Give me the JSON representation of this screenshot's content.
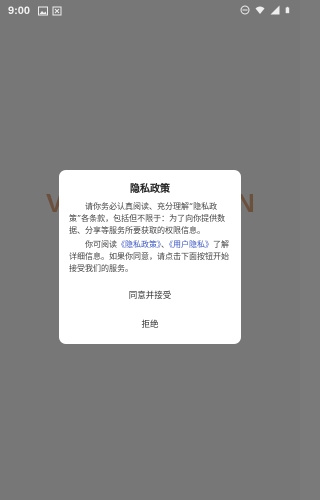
{
  "status_bar": {
    "time": "9:00",
    "left_icons": [
      "image-icon",
      "notification-icon"
    ],
    "right_icons": [
      "do-not-disturb-icon",
      "wifi-icon",
      "signal-icon",
      "battery-icon"
    ]
  },
  "background": {
    "splash_left": "V",
    "splash_right": "N"
  },
  "dialog": {
    "title": "隐私政策",
    "para1": "请你务必认真阅读、充分理解“隐私政策”各条款，包括但不限于：为了向你提供数据、分享等服务所要获取的权限信息。",
    "para2_prefix": "你可阅读",
    "link_privacy": "《隐私政策》",
    "para2_sep": "、",
    "link_user": "《用户隐私》",
    "para2_suffix": "了解详细信息。如果你同意，请点击下面按钮开始接受我们的服务。",
    "agree_label": "同意并接受",
    "refuse_label": "拒绝"
  },
  "colors": {
    "overlay": "#777777",
    "link": "#3b57c4",
    "dialog_bg": "#ffffff"
  }
}
